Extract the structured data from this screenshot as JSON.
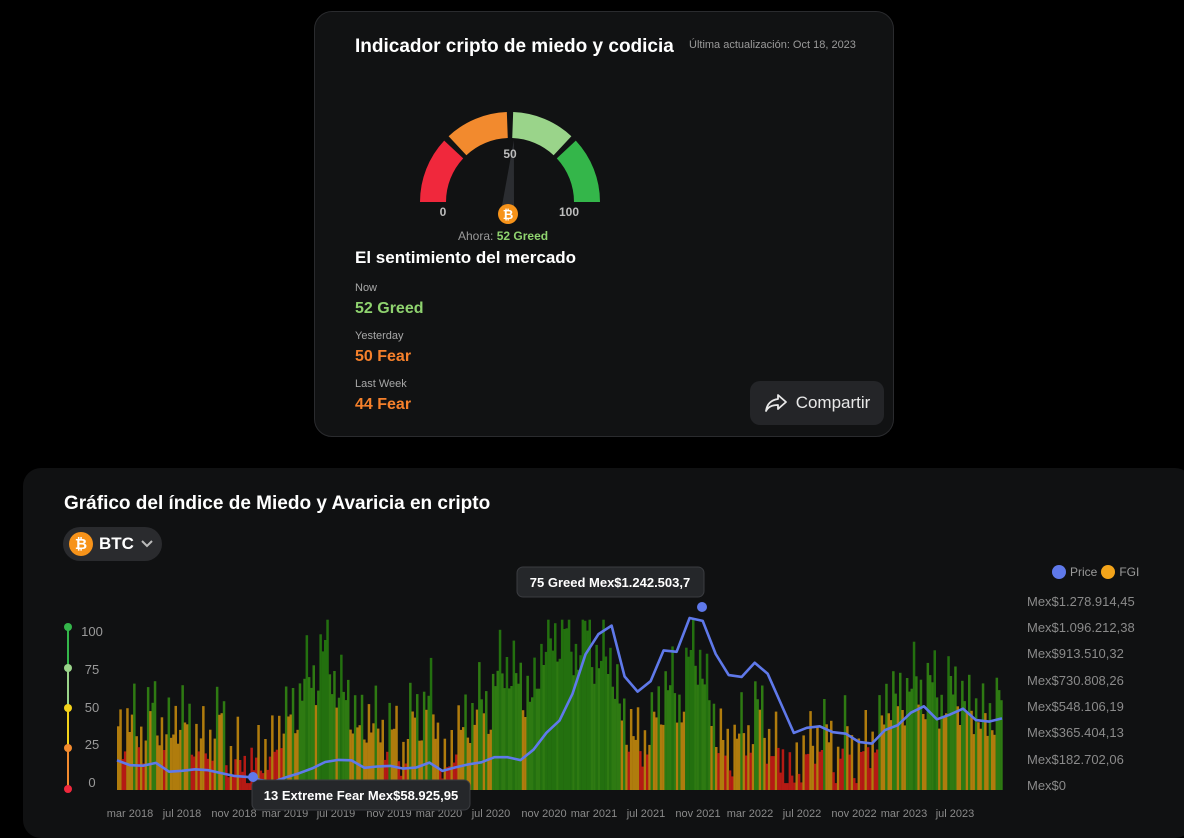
{
  "gauge_card": {
    "title": "Indicador cripto de miedo y codicia",
    "updated": "Última actualización: Oct 18, 2023",
    "gauge_min": "0",
    "gauge_mid": "50",
    "gauge_max": "100",
    "gauge_value": 52,
    "now_prefix": "Ahora:",
    "now_value": "52 Greed",
    "coin_icon": "bitcoin-icon",
    "colors": {
      "extreme_fear": "#f0283c",
      "fear": "#f28a2e",
      "greed": "#9ad48a",
      "extreme_greed": "#34b64a"
    }
  },
  "sentiment": {
    "title": "El sentimiento del mercado",
    "items": [
      {
        "label": "Now",
        "value": "52 Greed",
        "color": "#8fd36f"
      },
      {
        "label": "Yesterday",
        "value": "50 Fear",
        "color": "#f5802b"
      },
      {
        "label": "Last Week",
        "value": "44 Fear",
        "color": "#f5802b"
      }
    ]
  },
  "share": {
    "label": "Compartir",
    "icon": "share-arrow-icon"
  },
  "chart_card": {
    "title": "Gráfico del índice de Miedo y Avaricia en cripto",
    "coin": "BTC",
    "legend": [
      {
        "name": "Price",
        "color": "#5f79ea"
      },
      {
        "name": "FGI",
        "color": "#f3a41a"
      }
    ]
  },
  "chart_data": {
    "type": "bar",
    "x_ticks": [
      "mar 2018",
      "jul 2018",
      "nov 2018",
      "mar 2019",
      "jul 2019",
      "nov 2019",
      "mar 2020",
      "jul 2020",
      "nov 2020",
      "mar 2021",
      "jul 2021",
      "nov 2021",
      "mar 2022",
      "jul 2022",
      "nov 2022",
      "mar 2023",
      "jul 2023"
    ],
    "x_range": [
      "2018-02",
      "2023-10"
    ],
    "fgi_ticks": [
      100,
      75,
      50,
      25,
      0
    ],
    "fgi_range": [
      0,
      100
    ],
    "price_ticks": [
      "Mex$1.278.914,45",
      "Mex$1.096.212,38",
      "Mex$913.510,32",
      "Mex$730.808,26",
      "Mex$548.106,19",
      "Mex$365.404,13",
      "Mex$182.702,06",
      "Mex$0"
    ],
    "price_range": [
      0,
      1278914.45
    ],
    "fgi_monthly": {
      "months": [
        "2018-02",
        "2018-03",
        "2018-04",
        "2018-05",
        "2018-06",
        "2018-07",
        "2018-08",
        "2018-09",
        "2018-10",
        "2018-11",
        "2018-12",
        "2019-01",
        "2019-02",
        "2019-03",
        "2019-04",
        "2019-05",
        "2019-06",
        "2019-07",
        "2019-08",
        "2019-09",
        "2019-10",
        "2019-11",
        "2019-12",
        "2020-01",
        "2020-02",
        "2020-03",
        "2020-04",
        "2020-05",
        "2020-06",
        "2020-07",
        "2020-08",
        "2020-09",
        "2020-10",
        "2020-11",
        "2020-12",
        "2021-01",
        "2021-02",
        "2021-03",
        "2021-04",
        "2021-05",
        "2021-06",
        "2021-07",
        "2021-08",
        "2021-09",
        "2021-10",
        "2021-11",
        "2021-12",
        "2022-01",
        "2022-02",
        "2022-03",
        "2022-04",
        "2022-05",
        "2022-06",
        "2022-07",
        "2022-08",
        "2022-09",
        "2022-10",
        "2022-11",
        "2022-12",
        "2023-01",
        "2023-02",
        "2023-03",
        "2023-04",
        "2023-05",
        "2023-06",
        "2023-07",
        "2023-08",
        "2023-09",
        "2023-10"
      ],
      "values": [
        40,
        35,
        38,
        45,
        30,
        48,
        25,
        32,
        40,
        15,
        12,
        18,
        28,
        42,
        55,
        70,
        80,
        60,
        45,
        38,
        40,
        30,
        28,
        45,
        55,
        12,
        30,
        45,
        48,
        60,
        78,
        55,
        60,
        88,
        92,
        85,
        90,
        78,
        72,
        35,
        30,
        32,
        65,
        48,
        80,
        72,
        30,
        25,
        32,
        45,
        35,
        12,
        10,
        25,
        35,
        22,
        28,
        20,
        28,
        50,
        55,
        60,
        62,
        55,
        58,
        55,
        42,
        45,
        52
      ]
    },
    "price_monthly": {
      "values": [
        200000,
        180000,
        160000,
        170000,
        130000,
        140000,
        130000,
        125000,
        125000,
        100000,
        75000,
        65000,
        68000,
        85000,
        100000,
        150000,
        200000,
        195000,
        190000,
        160000,
        165000,
        150000,
        140000,
        165000,
        185000,
        115000,
        155000,
        185000,
        180000,
        210000,
        230000,
        210000,
        260000,
        380000,
        480000,
        650000,
        900000,
        1050000,
        1120000,
        760000,
        650000,
        740000,
        950000,
        920000,
        1150000,
        1150000,
        920000,
        760000,
        760000,
        870000,
        780000,
        570000,
        390000,
        430000,
        420000,
        380000,
        390000,
        330000,
        300000,
        400000,
        450000,
        520000,
        550000,
        480000,
        520000,
        540000,
        460000,
        470000,
        490000
      ]
    },
    "annotations": [
      {
        "text": "75 Greed Mex$1.242.503,7",
        "date": "2021-11",
        "price": 1242503.7
      },
      {
        "text": "13 Extreme Fear Mex$58.925,95",
        "date": "2019-02",
        "price": 58925.95
      }
    ]
  }
}
